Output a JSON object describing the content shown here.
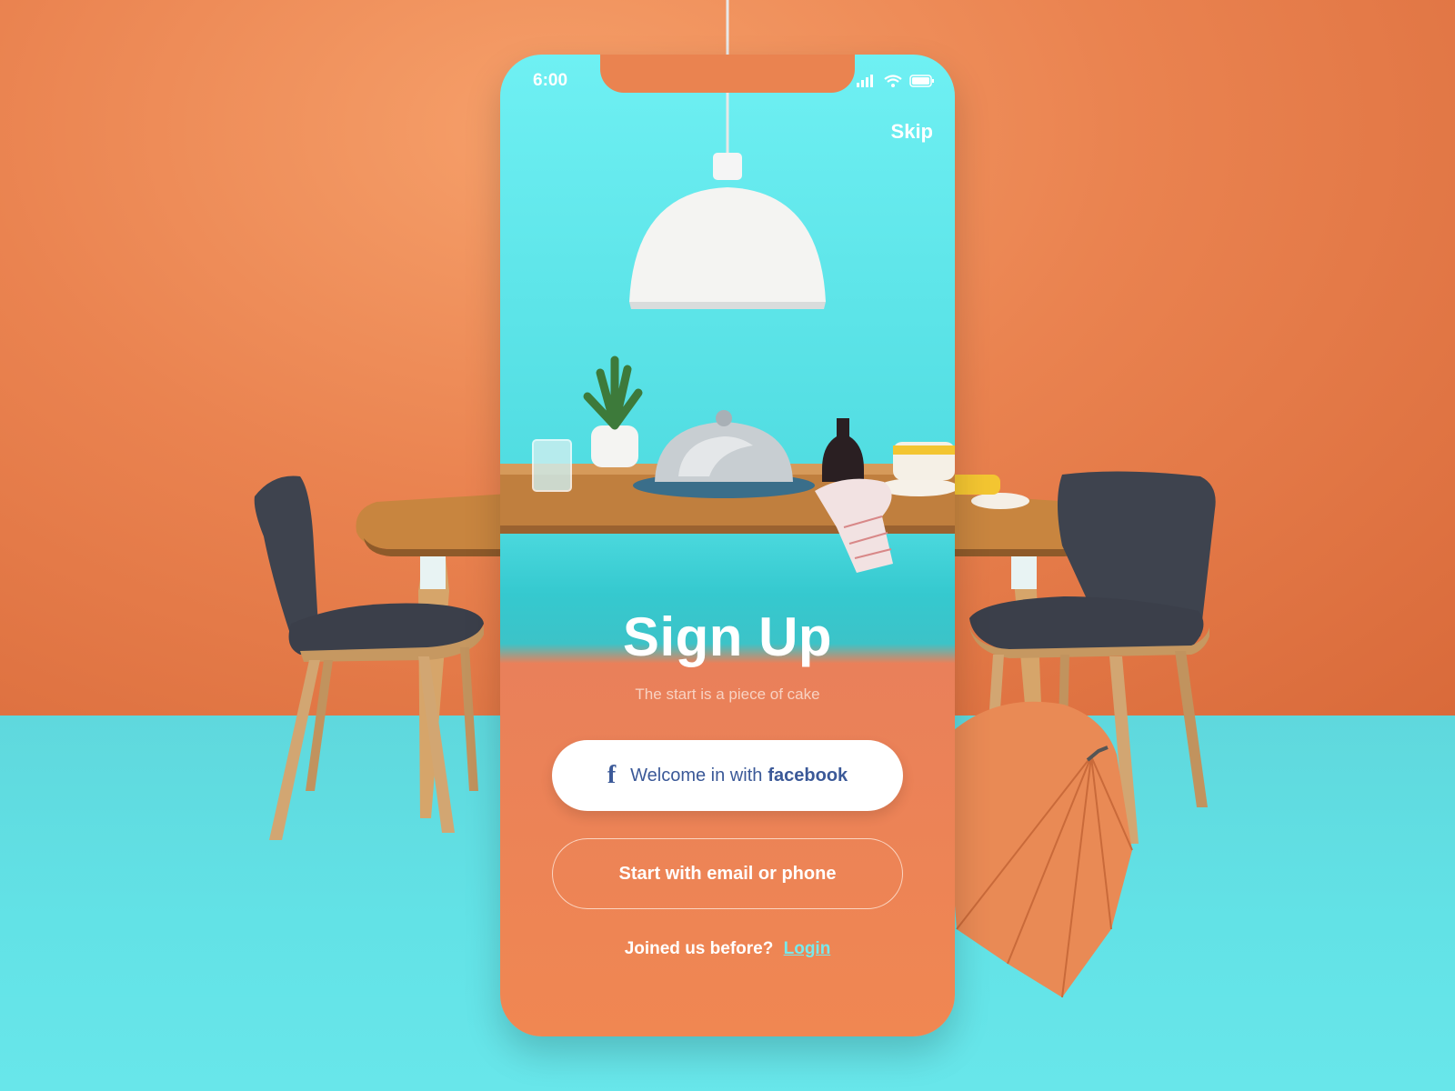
{
  "status_bar": {
    "time": "6:00"
  },
  "header": {
    "skip_label": "Skip"
  },
  "main": {
    "title": "Sign Up",
    "subtitle": "The start is a piece of cake",
    "facebook_button": {
      "prefix": "Welcome in with",
      "brand": "facebook"
    },
    "email_button_label": "Start with email or phone",
    "joined_prompt": "Joined us before?",
    "login_link": "Login"
  },
  "icons": {
    "facebook": "facebook-icon",
    "signal": "signal-icon",
    "wifi": "wifi-icon",
    "battery": "battery-icon"
  },
  "colors": {
    "wall": "#ea8350",
    "floor": "#62e2e6",
    "phone_top": "#6ff0f3",
    "phone_bottom": "#f08752",
    "facebook_blue": "#3b5998",
    "login_link": "#77e9ec"
  }
}
